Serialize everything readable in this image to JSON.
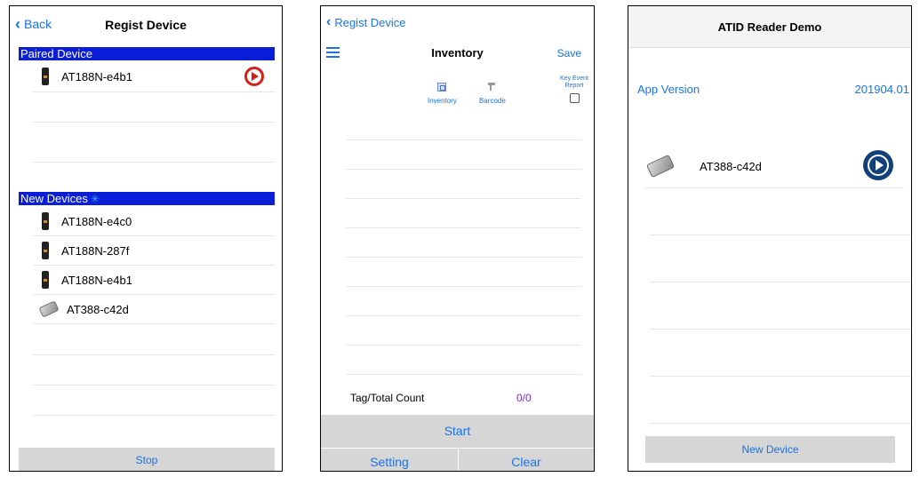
{
  "panel1": {
    "back_label": "Back",
    "title": "Regist Device",
    "paired_header": "Paired Device",
    "paired": [
      {
        "name": "AT188N-e4b1",
        "icon": "phone-icon"
      }
    ],
    "new_header": "New Devices",
    "new_devices": [
      {
        "name": "AT188N-e4c0",
        "icon": "phone-icon"
      },
      {
        "name": "AT188N-287f",
        "icon": "phone-icon"
      },
      {
        "name": "AT188N-e4b1",
        "icon": "phone-icon"
      },
      {
        "name": "AT388-c42d",
        "icon": "reader-icon"
      }
    ],
    "stop_label": "Stop"
  },
  "panel2": {
    "back_label": "Regist Device",
    "title": "Inventory",
    "save_label": "Save",
    "tabs": [
      {
        "label": "Inventory"
      },
      {
        "label": "Barcode"
      }
    ],
    "key_event_report": "Key Event Report",
    "tag_count_label": "Tag/Total Count",
    "tag_count_value": "0/0",
    "start_label": "Start",
    "setting_label": "Setting",
    "clear_label": "Clear"
  },
  "panel3": {
    "title": "ATID Reader Demo",
    "app_version_label": "App Version",
    "app_version_value": "201904.01",
    "device_name": "AT388-c42d",
    "new_device_label": "New Device"
  },
  "colors": {
    "accent": "#1a73e8",
    "section_header": "#0a1ed8",
    "play_red": "#d32019",
    "play_blue": "#12407a",
    "count": "#7a2ed0"
  }
}
